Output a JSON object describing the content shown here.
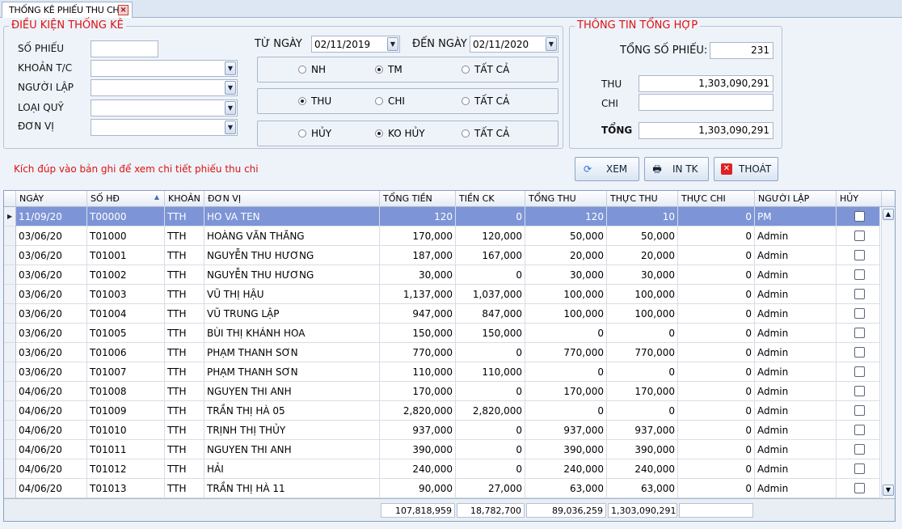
{
  "tab": {
    "title": "THỐNG KÊ PHIẾU THU CHI",
    "close": "×"
  },
  "filter": {
    "legend": "ĐIỀU KIỆN THỐNG KÊ",
    "so_phieu": "SỐ PHIẾU",
    "khoan_tc": "KHOẢN T/C",
    "nguoi_lap": "NGƯỜI LẬP",
    "loai_quy": "LOẠI QUỸ",
    "don_vi": "ĐƠN VỊ",
    "tu_ngay": "TỪ NGÀY",
    "tu_ngay_value": "02/11/2019",
    "den_ngay": "ĐẾN NGÀY",
    "den_ngay_value": "02/11/2020",
    "radio1": [
      "NH",
      "TM",
      "TẤT CẢ"
    ],
    "radio2": [
      "THU",
      "CHI",
      "TẤT CẢ"
    ],
    "radio3": [
      "HỦY",
      "KO HỦY",
      "TẤT CẢ"
    ]
  },
  "summary": {
    "legend": "THÔNG TIN TỔNG HỢP",
    "tong_so_phieu": "TỔNG SỐ PHIẾU:",
    "tong_so_phieu_value": "231",
    "thu": "THU",
    "thu_value": "1,303,090,291",
    "chi": "CHI",
    "chi_value": "",
    "tong": "TỔNG",
    "tong_value": "1,303,090,291"
  },
  "hint": "Kích đúp vào bản ghi để xem chi tiết phiếu thu chi",
  "buttons": {
    "xem": "XEM",
    "in_tk": "IN TK",
    "thoat": "THOÁT"
  },
  "grid": {
    "headers": [
      "NGÀY",
      "SỐ HĐ",
      "KHOẢN",
      "ĐƠN VỊ",
      "TỔNG TIỀN",
      "TIỀN CK",
      "TỔNG THU",
      "THỰC THU",
      "THỰC CHI",
      "NGƯỜI LẬP",
      "HỦY"
    ],
    "rows": [
      [
        "11/09/20",
        "T00000",
        "TTH",
        "HO VA TEN",
        "120",
        "0",
        "120",
        "10",
        "0",
        "PM"
      ],
      [
        "03/06/20",
        "T01000",
        "TTH",
        "HOÀNG VĂN THĂNG",
        "170,000",
        "120,000",
        "50,000",
        "50,000",
        "0",
        "Admin"
      ],
      [
        "03/06/20",
        "T01001",
        "TTH",
        "NGUYỄN THU HƯƠNG",
        "187,000",
        "167,000",
        "20,000",
        "20,000",
        "0",
        "Admin"
      ],
      [
        "03/06/20",
        "T01002",
        "TTH",
        "NGUYỄN THU HƯƠNG",
        "30,000",
        "0",
        "30,000",
        "30,000",
        "0",
        "Admin"
      ],
      [
        "03/06/20",
        "T01003",
        "TTH",
        "VŨ THỊ HẬU",
        "1,137,000",
        "1,037,000",
        "100,000",
        "100,000",
        "0",
        "Admin"
      ],
      [
        "03/06/20",
        "T01004",
        "TTH",
        "VŨ TRUNG LẬP",
        "947,000",
        "847,000",
        "100,000",
        "100,000",
        "0",
        "Admin"
      ],
      [
        "03/06/20",
        "T01005",
        "TTH",
        "BÙI THỊ KHÁNH HOA",
        "150,000",
        "150,000",
        "0",
        "0",
        "0",
        "Admin"
      ],
      [
        "03/06/20",
        "T01006",
        "TTH",
        "PHẠM THANH SƠN",
        "770,000",
        "0",
        "770,000",
        "770,000",
        "0",
        "Admin"
      ],
      [
        "03/06/20",
        "T01007",
        "TTH",
        "PHẠM THANH SƠN",
        "110,000",
        "110,000",
        "0",
        "0",
        "0",
        "Admin"
      ],
      [
        "04/06/20",
        "T01008",
        "TTH",
        "NGUYEN THI ANH",
        "170,000",
        "0",
        "170,000",
        "170,000",
        "0",
        "Admin"
      ],
      [
        "04/06/20",
        "T01009",
        "TTH",
        "TRẦN THỊ HÀ 05",
        "2,820,000",
        "2,820,000",
        "0",
        "0",
        "0",
        "Admin"
      ],
      [
        "04/06/20",
        "T01010",
        "TTH",
        "TRỊNH THỊ THỦY",
        "937,000",
        "0",
        "937,000",
        "937,000",
        "0",
        "Admin"
      ],
      [
        "04/06/20",
        "T01011",
        "TTH",
        "NGUYEN THI ANH",
        "390,000",
        "0",
        "390,000",
        "390,000",
        "0",
        "Admin"
      ],
      [
        "04/06/20",
        "T01012",
        "TTH",
        "HẢI",
        "240,000",
        "0",
        "240,000",
        "240,000",
        "0",
        "Admin"
      ],
      [
        "04/06/20",
        "T01013",
        "TTH",
        "TRẦN THỊ HÀ 11",
        "90,000",
        "27,000",
        "63,000",
        "63,000",
        "0",
        "Admin"
      ]
    ],
    "totals": [
      "107,818,959",
      "18,782,700",
      "89,036,259",
      "1,303,090,291",
      ""
    ]
  }
}
